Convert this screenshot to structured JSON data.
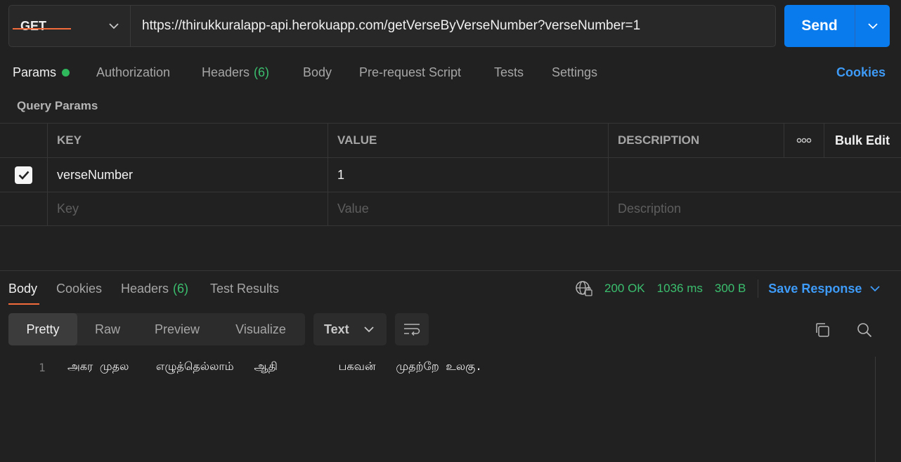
{
  "request": {
    "method": "GET",
    "url": "https://thirukkuralapp-api.herokuapp.com/getVerseByVerseNumber?verseNumber=1",
    "send_label": "Send"
  },
  "request_tabs": [
    {
      "label": "Params",
      "count": "",
      "active": true
    },
    {
      "label": "Authorization",
      "count": ""
    },
    {
      "label": "Headers",
      "count": "(6)"
    },
    {
      "label": "Body",
      "count": ""
    },
    {
      "label": "Pre-request Script",
      "count": ""
    },
    {
      "label": "Tests",
      "count": ""
    },
    {
      "label": "Settings",
      "count": ""
    }
  ],
  "cookies_link": "Cookies",
  "query_params": {
    "title": "Query Params",
    "headers": {
      "key": "KEY",
      "value": "VALUE",
      "description": "DESCRIPTION",
      "more": "ooo",
      "bulk_edit": "Bulk Edit"
    },
    "rows": [
      {
        "checked": true,
        "key": "verseNumber",
        "value": "1",
        "description": ""
      }
    ],
    "placeholders": {
      "key": "Key",
      "value": "Value",
      "description": "Description"
    }
  },
  "response": {
    "tabs": [
      {
        "label": "Body",
        "count": "",
        "active": true
      },
      {
        "label": "Cookies",
        "count": ""
      },
      {
        "label": "Headers",
        "count": "(6)"
      },
      {
        "label": "Test Results",
        "count": ""
      }
    ],
    "status": "200 OK",
    "time": "1036 ms",
    "size": "300 B",
    "save_label": "Save Response",
    "view_modes": [
      "Pretty",
      "Raw",
      "Preview",
      "Visualize"
    ],
    "format": "Text",
    "body_lines": [
      {
        "number": "1",
        "text": "அகர முதல    எழுத்தெல்லாம்   ஆதி         பகவன்   முதற்றே உலகு."
      }
    ]
  },
  "colors": {
    "accent": "#097bed",
    "success": "#3bbf6e",
    "active_tab": "#f26b3a",
    "link": "#3e9bf7"
  }
}
